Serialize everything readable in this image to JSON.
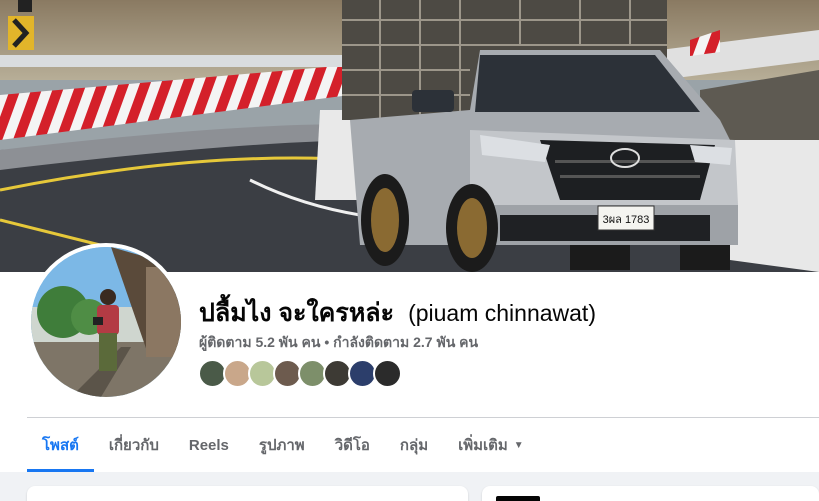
{
  "profile": {
    "name": "ปลื้มไง จะใครหล่ะ",
    "alternate_name": "(piuam chinnawat)",
    "stats": "ผู้ติดตาม 5.2 พัน คน • กำลังติดตาม 2.7 พัน คน"
  },
  "followers_preview": [
    {
      "color": "#4a5a48"
    },
    {
      "color": "#c9a78a"
    },
    {
      "color": "#b8c79a"
    },
    {
      "color": "#6d5b4e"
    },
    {
      "color": "#7d8f6a"
    },
    {
      "color": "#3d3a34"
    },
    {
      "color": "#2c3e6b"
    },
    {
      "color": "#2b2b2b"
    }
  ],
  "tabs": [
    {
      "label": "โพสต์",
      "active": true
    },
    {
      "label": "เกี่ยวกับ",
      "active": false
    },
    {
      "label": "Reels",
      "active": false
    },
    {
      "label": "รูปภาพ",
      "active": false
    },
    {
      "label": "วิดีโอ",
      "active": false
    },
    {
      "label": "กลุ่ม",
      "active": false
    },
    {
      "label": "เพิ่มเติม",
      "active": false
    }
  ],
  "cover": {
    "license_plate": "3ผล 1783"
  },
  "colors": {
    "accent": "#1877f2",
    "text_primary": "#050505",
    "text_secondary": "#65676b",
    "background": "#f0f2f5"
  }
}
